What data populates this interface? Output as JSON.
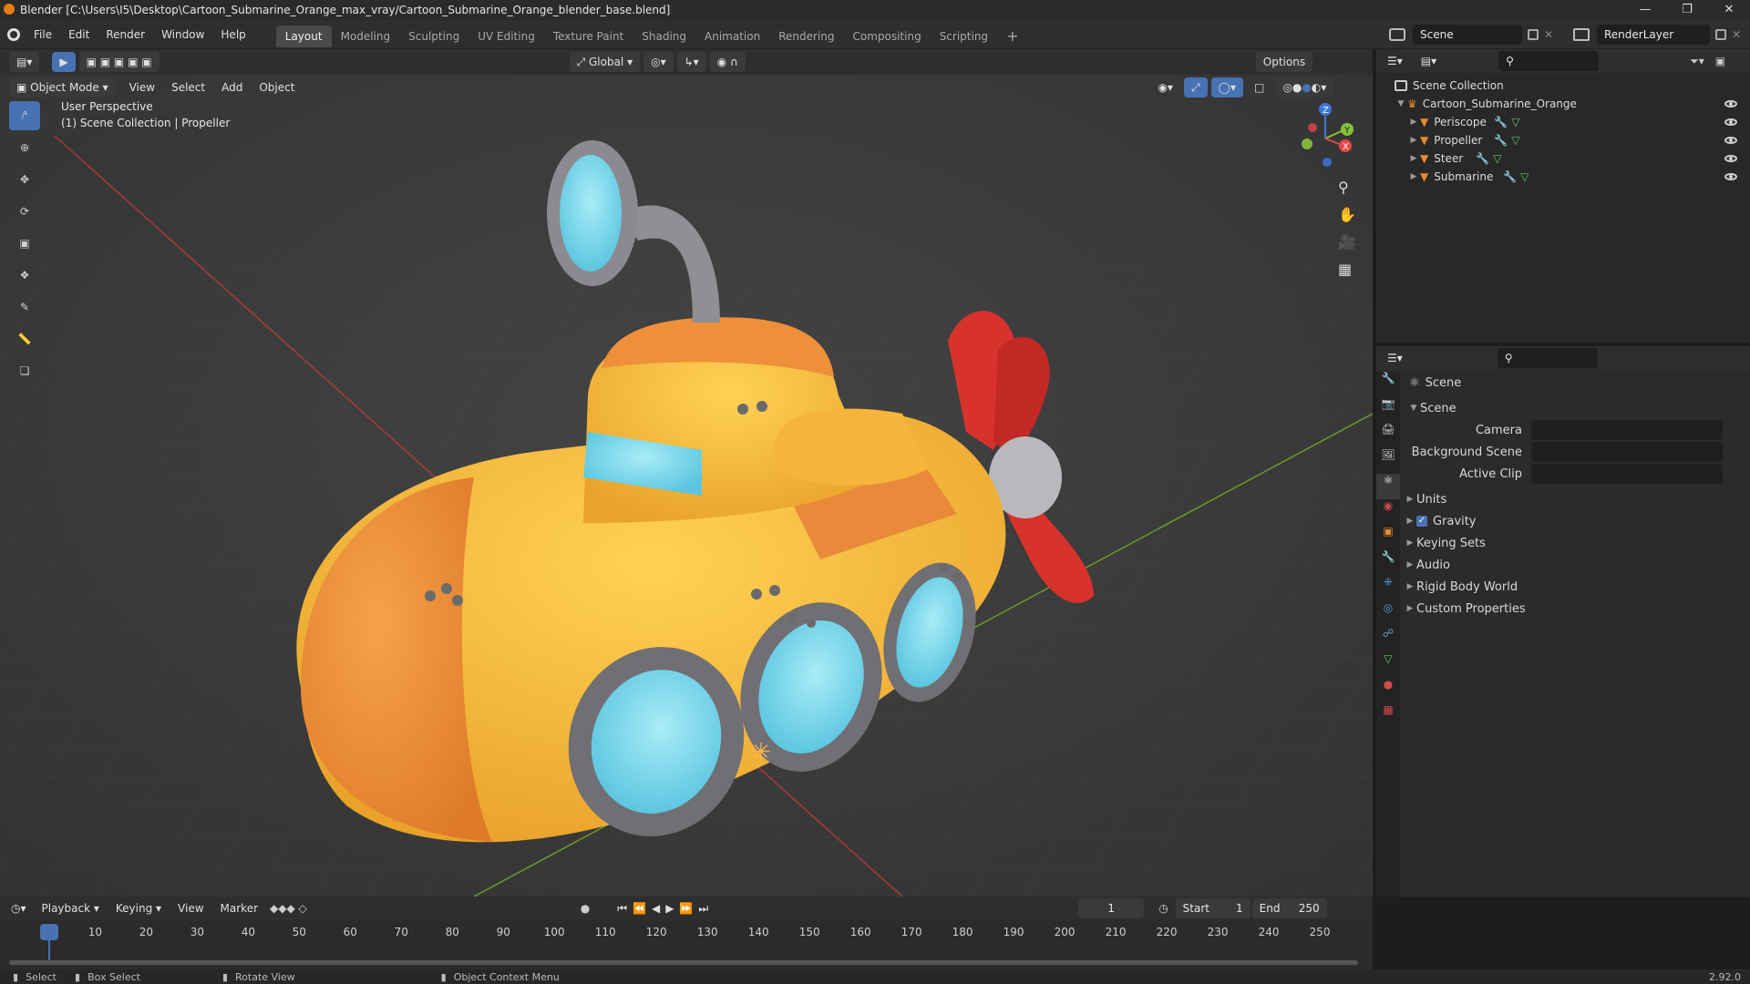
{
  "window": {
    "title": "Blender [C:\\Users\\I5\\Desktop\\Cartoon_Submarine_Orange_max_vray/Cartoon_Submarine_Orange_blender_base.blend]"
  },
  "menus": [
    "File",
    "Edit",
    "Render",
    "Window",
    "Help"
  ],
  "workspaces": [
    "Layout",
    "Modeling",
    "Sculpting",
    "UV Editing",
    "Texture Paint",
    "Shading",
    "Animation",
    "Rendering",
    "Compositing",
    "Scripting"
  ],
  "active_workspace": "Layout",
  "scene": {
    "name": "Scene",
    "layer": "RenderLayer"
  },
  "viewport": {
    "transform": "Global",
    "options": "Options",
    "mode": "Object Mode",
    "menus": [
      "View",
      "Select",
      "Add",
      "Object"
    ],
    "overlay_title": "User Perspective",
    "overlay_sub": "(1) Scene Collection | Propeller",
    "gizmo": {
      "x": "X",
      "y": "Y",
      "z": "Z"
    }
  },
  "outliner": {
    "root": "Scene Collection",
    "collection": "Cartoon_Submarine_Orange",
    "objects": [
      "Periscope",
      "Propeller",
      "Steer",
      "Submarine"
    ]
  },
  "properties": {
    "header": "Scene",
    "panel": "Scene",
    "fields": [
      {
        "label": "Camera",
        "value": ""
      },
      {
        "label": "Background Scene",
        "value": ""
      },
      {
        "label": "Active Clip",
        "value": ""
      }
    ],
    "sections": [
      "Units",
      "Gravity",
      "Keying Sets",
      "Audio",
      "Rigid Body World",
      "Custom Properties"
    ],
    "gravity_checked": true
  },
  "timeline": {
    "menus": [
      "Playback",
      "Keying",
      "View",
      "Marker"
    ],
    "current": "1",
    "start_label": "Start",
    "start": "1",
    "end_label": "End",
    "end": "250",
    "ticks": [
      "1",
      "10",
      "20",
      "30",
      "40",
      "50",
      "60",
      "70",
      "80",
      "90",
      "100",
      "110",
      "120",
      "130",
      "140",
      "150",
      "160",
      "170",
      "180",
      "190",
      "200",
      "210",
      "220",
      "230",
      "240",
      "250"
    ]
  },
  "status": {
    "select": "Select",
    "box": "Box Select",
    "rotate": "Rotate View",
    "context": "Object Context Menu",
    "version": "2.92.0"
  },
  "colors": {
    "accent": "#4772b3",
    "sub_body": "#f4b43a",
    "sub_nose": "#ee8f3a",
    "window": "#7dd4e8",
    "propeller": "#d8322c"
  }
}
